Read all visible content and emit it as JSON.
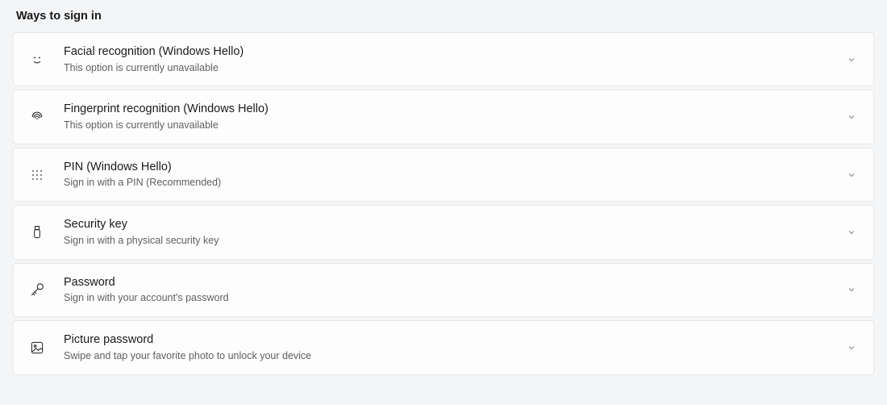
{
  "section_heading": "Ways to sign in",
  "options": [
    {
      "title": "Facial recognition (Windows Hello)",
      "subtitle": "This option is currently unavailable"
    },
    {
      "title": "Fingerprint recognition (Windows Hello)",
      "subtitle": "This option is currently unavailable"
    },
    {
      "title": "PIN (Windows Hello)",
      "subtitle": "Sign in with a PIN (Recommended)"
    },
    {
      "title": "Security key",
      "subtitle": "Sign in with a physical security key"
    },
    {
      "title": "Password",
      "subtitle": "Sign in with your account's password"
    },
    {
      "title": "Picture password",
      "subtitle": "Swipe and tap your favorite photo to unlock your device"
    }
  ]
}
